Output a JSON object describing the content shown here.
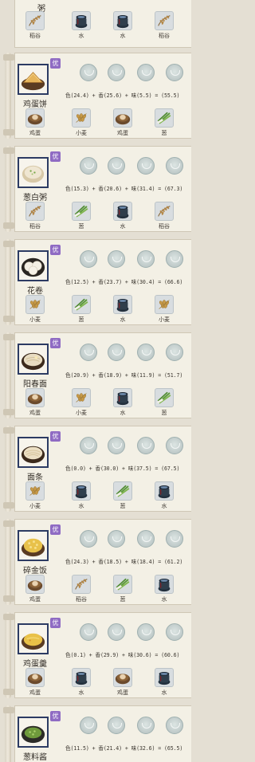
{
  "top_partial": {
    "name": "粥",
    "formula": "",
    "ingredients": [
      {
        "label": "稻谷",
        "icon": "rice-grain-icon"
      },
      {
        "label": "水",
        "icon": "water-jar-icon"
      },
      {
        "label": "水",
        "icon": "water-jar-icon"
      },
      {
        "label": "稻谷",
        "icon": "rice-grain-icon"
      }
    ]
  },
  "tag_label": "优",
  "recipes": [
    {
      "name": "鸡蛋饼",
      "icon": "egg-pancake-icon",
      "formula": "色(24.4) + 香(25.6) + 味(5.5) = (55.5)",
      "ingredients": [
        {
          "label": "鸡蛋",
          "icon": "egg-basket-icon"
        },
        {
          "label": "小麦",
          "icon": "wheat-icon"
        },
        {
          "label": "鸡蛋",
          "icon": "egg-basket-icon"
        },
        {
          "label": "葱",
          "icon": "scallion-icon"
        }
      ]
    },
    {
      "name": "葱白粥",
      "icon": "scallion-porridge-icon",
      "formula": "色(15.3) + 香(20.6) + 味(31.4) = (67.3)",
      "ingredients": [
        {
          "label": "稻谷",
          "icon": "rice-grain-icon"
        },
        {
          "label": "葱",
          "icon": "scallion-icon"
        },
        {
          "label": "水",
          "icon": "water-jar-icon"
        },
        {
          "label": "稻谷",
          "icon": "rice-grain-icon"
        }
      ]
    },
    {
      "name": "花卷",
      "icon": "flower-roll-icon",
      "formula": "色(12.5) + 香(23.7) + 味(30.4) = (66.6)",
      "ingredients": [
        {
          "label": "小麦",
          "icon": "wheat-icon"
        },
        {
          "label": "葱",
          "icon": "scallion-icon"
        },
        {
          "label": "水",
          "icon": "water-jar-icon"
        },
        {
          "label": "小麦",
          "icon": "wheat-icon"
        }
      ]
    },
    {
      "name": "阳春面",
      "icon": "plain-noodle-soup-icon",
      "formula": "色(20.9) + 香(18.9) + 味(11.9) = (51.7)",
      "ingredients": [
        {
          "label": "鸡蛋",
          "icon": "egg-basket-icon"
        },
        {
          "label": "小麦",
          "icon": "wheat-icon"
        },
        {
          "label": "水",
          "icon": "water-jar-icon"
        },
        {
          "label": "葱",
          "icon": "scallion-icon"
        }
      ]
    },
    {
      "name": "面条",
      "icon": "noodle-bowl-icon",
      "formula": "色(0.0) + 香(30.0) + 味(37.5) = (67.5)",
      "ingredients": [
        {
          "label": "小麦",
          "icon": "wheat-icon"
        },
        {
          "label": "水",
          "icon": "water-jar-icon"
        },
        {
          "label": "葱",
          "icon": "scallion-icon"
        },
        {
          "label": "水",
          "icon": "water-jar-icon"
        }
      ]
    },
    {
      "name": "碎金饭",
      "icon": "egg-fried-rice-icon",
      "formula": "色(24.3) + 香(18.5) + 味(18.4) = (61.2)",
      "ingredients": [
        {
          "label": "鸡蛋",
          "icon": "egg-basket-icon"
        },
        {
          "label": "稻谷",
          "icon": "rice-grain-icon"
        },
        {
          "label": "葱",
          "icon": "scallion-icon"
        },
        {
          "label": "水",
          "icon": "water-jar-icon"
        }
      ]
    },
    {
      "name": "鸡蛋羹",
      "icon": "steamed-egg-icon",
      "formula": "色(0.1) + 香(29.9) + 味(30.6) = (60.6)",
      "ingredients": [
        {
          "label": "鸡蛋",
          "icon": "egg-basket-icon"
        },
        {
          "label": "水",
          "icon": "water-jar-icon"
        },
        {
          "label": "鸡蛋",
          "icon": "egg-basket-icon"
        },
        {
          "label": "水",
          "icon": "water-jar-icon"
        }
      ]
    },
    {
      "name": "葱料酱",
      "icon": "scallion-sauce-icon",
      "formula": "色(11.5) + 香(21.4) + 味(32.6) = (65.5)",
      "ingredients": []
    }
  ]
}
